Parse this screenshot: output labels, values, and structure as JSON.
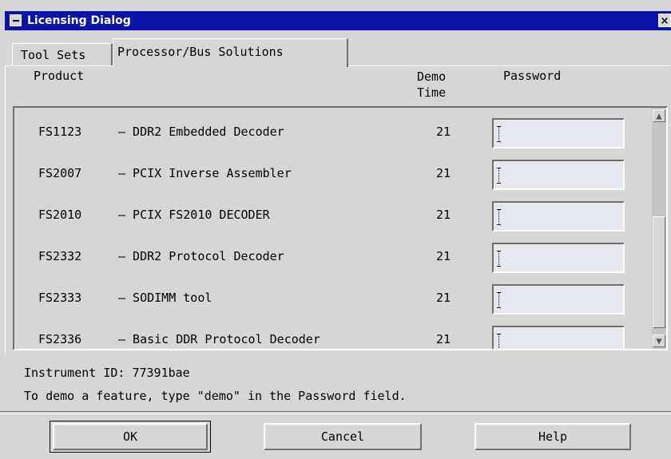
{
  "window": {
    "title": "Licensing Dialog",
    "close_glyph": "×"
  },
  "tabs": [
    {
      "label": "Tool Sets",
      "active": false
    },
    {
      "label": "Processor/Bus Solutions",
      "active": true
    }
  ],
  "columns": {
    "product": "Product",
    "demo_line1": "Demo",
    "demo_line2": "Time",
    "password": "Password"
  },
  "products": [
    {
      "code": "FS1123",
      "desc": "– DDR2 Embedded Decoder",
      "days": "21",
      "password": ""
    },
    {
      "code": "FS2007",
      "desc": "– PCIX Inverse Assembler",
      "days": "21",
      "password": ""
    },
    {
      "code": "FS2010",
      "desc": "– PCIX FS2010 DECODER",
      "days": "21",
      "password": ""
    },
    {
      "code": "FS2332",
      "desc": "– DDR2 Protocol Decoder",
      "days": "21",
      "password": ""
    },
    {
      "code": "FS2333",
      "desc": "– SODIMM tool",
      "days": "21",
      "password": ""
    },
    {
      "code": "FS2336",
      "desc": "– Basic DDR Protocol Decoder",
      "days": "21",
      "password": ""
    }
  ],
  "scrollbar": {
    "up_glyph": "▲",
    "down_glyph": "▼"
  },
  "instrument_id": "Instrument ID: 77391bae",
  "hint": "To demo a feature, type \"demo\" in the Password field.",
  "buttons": {
    "ok": "OK",
    "cancel": "Cancel",
    "help": "Help"
  }
}
